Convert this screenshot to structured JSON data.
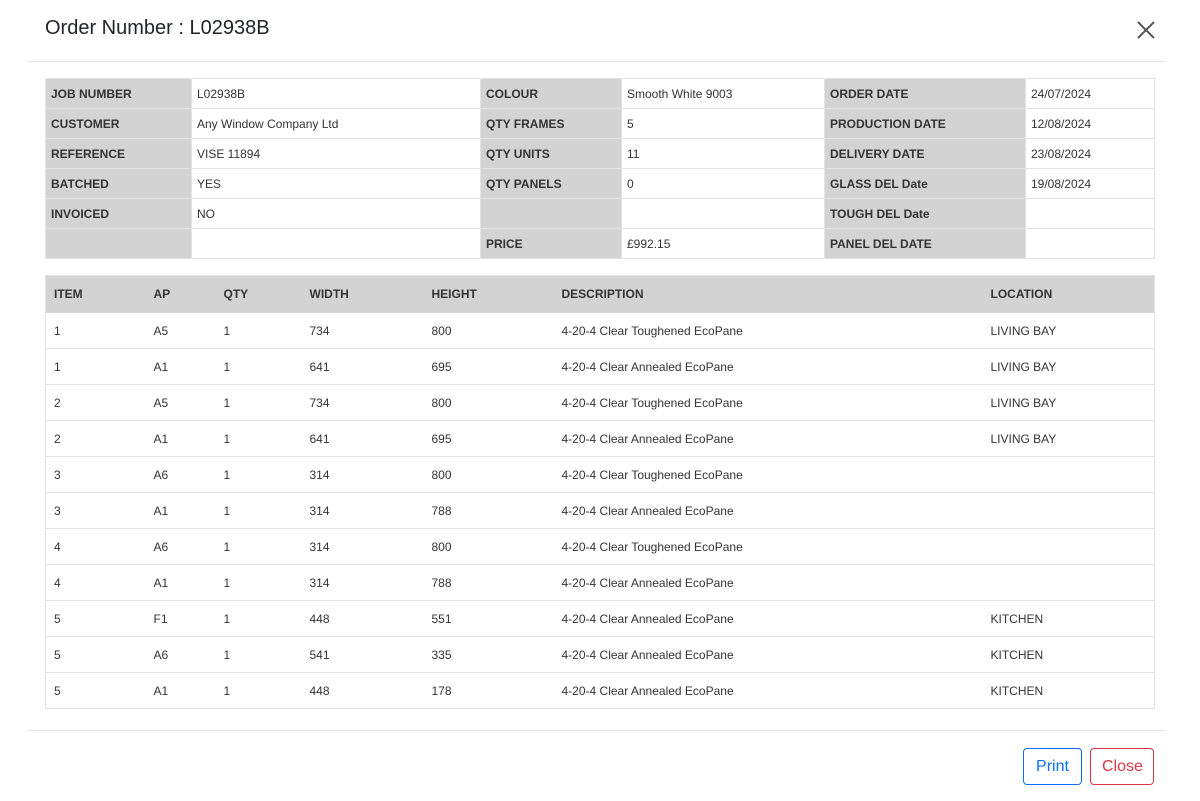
{
  "modal": {
    "title": "Order Number : L02938B"
  },
  "info": {
    "rows": [
      [
        "JOB NUMBER",
        "L02938B",
        "COLOUR",
        "Smooth White 9003",
        "ORDER DATE",
        "24/07/2024"
      ],
      [
        "CUSTOMER",
        "Any Window Company Ltd",
        "QTY FRAMES",
        "5",
        "PRODUCTION DATE",
        "12/08/2024"
      ],
      [
        "REFERENCE",
        "VISE 11894",
        "QTY UNITS",
        "11",
        "DELIVERY DATE",
        "23/08/2024"
      ],
      [
        "BATCHED",
        "YES",
        "QTY PANELS",
        "0",
        "GLASS DEL Date",
        "19/08/2024"
      ],
      [
        "INVOICED",
        "NO",
        "",
        "",
        "TOUGH DEL Date",
        ""
      ],
      [
        "",
        "",
        "PRICE",
        "£992.15",
        "PANEL DEL DATE",
        ""
      ]
    ]
  },
  "items": {
    "columns": [
      "ITEM",
      "AP",
      "QTY",
      "WIDTH",
      "HEIGHT",
      "DESCRIPTION",
      "LOCATION"
    ],
    "rows": [
      [
        "1",
        "A5",
        "1",
        "734",
        "800",
        "4-20-4 Clear Toughened EcoPane",
        "LIVING BAY"
      ],
      [
        "1",
        "A1",
        "1",
        "641",
        "695",
        "4-20-4 Clear Annealed EcoPane",
        "LIVING BAY"
      ],
      [
        "2",
        "A5",
        "1",
        "734",
        "800",
        "4-20-4 Clear Toughened EcoPane",
        "LIVING BAY"
      ],
      [
        "2",
        "A1",
        "1",
        "641",
        "695",
        "4-20-4 Clear Annealed EcoPane",
        "LIVING BAY"
      ],
      [
        "3",
        "A6",
        "1",
        "314",
        "800",
        "4-20-4 Clear Toughened EcoPane",
        ""
      ],
      [
        "3",
        "A1",
        "1",
        "314",
        "788",
        "4-20-4 Clear Annealed EcoPane",
        ""
      ],
      [
        "4",
        "A6",
        "1",
        "314",
        "800",
        "4-20-4 Clear Toughened EcoPane",
        ""
      ],
      [
        "4",
        "A1",
        "1",
        "314",
        "788",
        "4-20-4 Clear Annealed EcoPane",
        ""
      ],
      [
        "5",
        "F1",
        "1",
        "448",
        "551",
        "4-20-4 Clear Annealed EcoPane",
        "KITCHEN"
      ],
      [
        "5",
        "A6",
        "1",
        "541",
        "335",
        "4-20-4 Clear Annealed EcoPane",
        "KITCHEN"
      ],
      [
        "5",
        "A1",
        "1",
        "448",
        "178",
        "4-20-4 Clear Annealed EcoPane",
        "KITCHEN"
      ]
    ]
  },
  "footer": {
    "print_label": "Print",
    "close_label": "Close"
  },
  "colors": {
    "label_bg": "#d3d3d3",
    "print_accent": "#0d6efd",
    "close_accent": "#dc3545"
  }
}
